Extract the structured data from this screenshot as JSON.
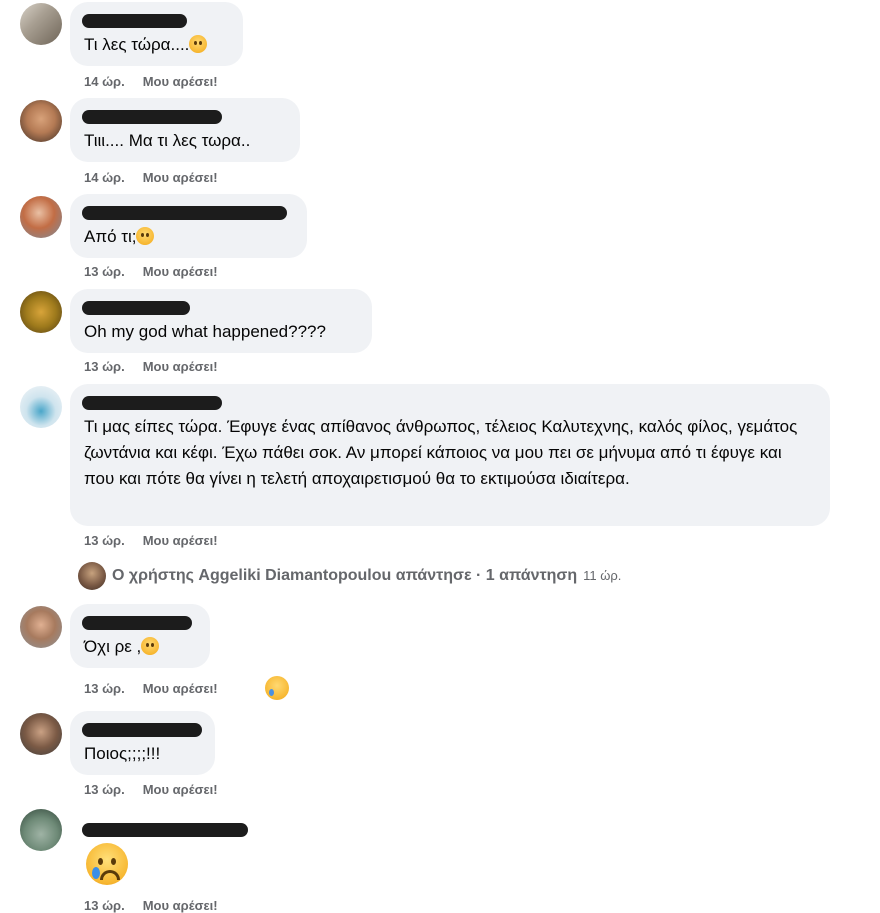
{
  "comments": [
    {
      "text": "Τι λες τώρα....",
      "emoji": "pleading-face",
      "time": "14 ώρ.",
      "like": "Μου αρέσει!"
    },
    {
      "text": "Τιιι.... Μα τι λες τωρα..",
      "time": "14 ώρ.",
      "like": "Μου αρέσει!"
    },
    {
      "text": "Από τι;",
      "emoji": "sad-face",
      "time": "13 ώρ.",
      "like": "Μου αρέσει!"
    },
    {
      "text": "Oh my god what happened????",
      "time": "13 ώρ.",
      "like": "Μου αρέσει!"
    },
    {
      "text": "Τι μας είπες τώρα. Έφυγε ένας απίθανος άνθρωπος, τέλειος Καλυτεχνης, καλός φίλος, γεμάτος ζωντάνια και κέφι. Έχω πάθει σοκ. Αν μπορεί κάποιος να μου πει σε μήνυμα από τι έφυγε και που και πότε θα γίνει η τελετή αποχαιρετισμού θα το εκτιμούσα ιδιαίτερα.",
      "time": "13 ώρ.",
      "like": "Μου αρέσει!"
    },
    {
      "text": "Όχι ρε ,",
      "emoji": "pensive-face",
      "time": "13 ώρ.",
      "like": "Μου αρέσει!",
      "reaction": "crying-face"
    },
    {
      "text": "Ποιος;;;;!!!",
      "time": "13 ώρ.",
      "like": "Μου αρέσει!"
    },
    {
      "emoji_only": "crying-face",
      "time": "13 ώρ.",
      "like": "Μου αρέσει!"
    }
  ],
  "reply_thread": {
    "text": "Ο χρήστης Aggeliki Diamantopoulou απάντησε · 1 απάντηση",
    "time": "11 ώρ."
  }
}
